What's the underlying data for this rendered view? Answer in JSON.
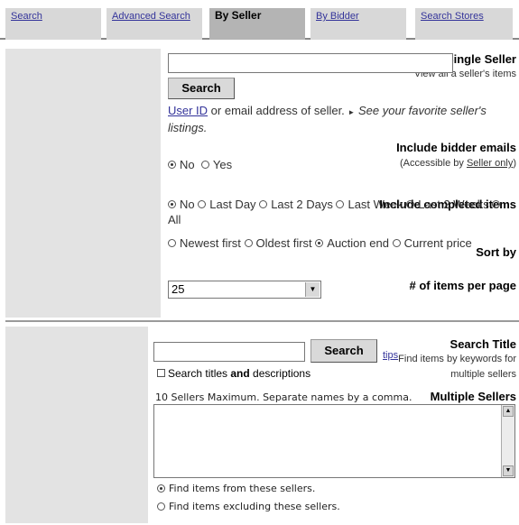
{
  "tabs": [
    {
      "label": "Search"
    },
    {
      "label": "Advanced Search"
    },
    {
      "label": "By Seller"
    },
    {
      "label": "By Bidder"
    },
    {
      "label": "Search Stores"
    }
  ],
  "single_seller": {
    "label": "Single Seller",
    "sub": "View all a seller's items",
    "input_value": "",
    "button": "Search",
    "help_link": "User ID",
    "help_text": " or email address of seller. ",
    "favorite_text": "See your favorite seller's listings."
  },
  "bidder_emails": {
    "label": "Include bidder emails",
    "sub_prefix": "(Accessible by ",
    "sub_link": "Seller only",
    "sub_suffix": ")",
    "options": [
      "No",
      "Yes"
    ],
    "selected": "No"
  },
  "completed": {
    "label": "Include completed items",
    "options": [
      "No",
      "Last Day",
      "Last 2 Days",
      "Last Week",
      "Last 2 Weeks",
      "All"
    ],
    "selected": "No"
  },
  "sort": {
    "label": "Sort by",
    "options": [
      "Newest first",
      "Oldest first",
      "Auction end",
      "Current price"
    ],
    "selected": "Auction end"
  },
  "per_page": {
    "label": "# of items per page",
    "value": "25"
  },
  "search_title": {
    "label": "Search Title",
    "sub": "Find items by keywords for multiple sellers",
    "input_value": "",
    "button": "Search",
    "tips": "tips",
    "check_pre": "Search titles ",
    "check_bold": "and",
    "check_post": " descriptions"
  },
  "multiple": {
    "label": "Multiple Sellers",
    "hint": "10 Sellers Maximum. Separate names by a comma.",
    "value": "",
    "options": [
      "Find items from these sellers.",
      "Find items excluding these sellers."
    ],
    "selected": "Find items from these sellers."
  }
}
